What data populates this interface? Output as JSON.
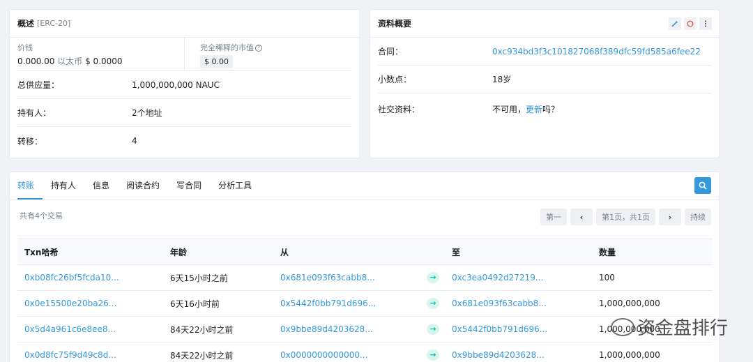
{
  "overview": {
    "title": "概述",
    "subtitle": "[ERC-20]",
    "price_label": "价钱",
    "price_value": "0.000.00",
    "price_eth": "以太币",
    "price_usd": "$ 0.0000",
    "mcap_label": "完全稀释的市值",
    "mcap_value": "$ 0.00",
    "rows": [
      {
        "label": "总供应量：",
        "value": "1,000,000,000 NAUC"
      },
      {
        "label": "持有人：",
        "value": "2个地址"
      },
      {
        "label": "转移：",
        "value": "4"
      }
    ]
  },
  "profile": {
    "title": "资料概要",
    "contract_label": "合同：",
    "contract_value": "0xc934bd3f3c101827068f389dfc59fd585a6fee22",
    "decimals_label": "小数点：",
    "decimals_value": "18岁",
    "social_label": "社交资料：",
    "social_prefix": "不可用，",
    "social_link": "更新",
    "social_suffix": "吗？"
  },
  "tabs": [
    "转账",
    "持有人",
    "信息",
    "阅读合约",
    "写合同",
    "分析工具"
  ],
  "toolbar": {
    "count_text": "共有4个交易",
    "first": "第一",
    "page_info": "第1页，共1页",
    "last": "持续"
  },
  "table": {
    "headers": [
      "Txn哈希",
      "年龄",
      "从",
      "",
      "至",
      "数量"
    ],
    "rows": [
      {
        "hash": "0xb08fc26bf5fcda10...",
        "age": "6天15小时之前",
        "from": "0x681e093f63cabb8...",
        "to": "0xc3ea0492d27219...",
        "qty": "100"
      },
      {
        "hash": "0x0e15500e20ba26...",
        "age": "6天16小时前",
        "from": "0x5442f0bb791d696...",
        "to": "0x681e093f63cabb8...",
        "qty": "1,000,000,000"
      },
      {
        "hash": "0x5d4a961c6e8ee8...",
        "age": "84天22小时之前",
        "from": "0x9bbe89d4203628...",
        "to": "0x5442f0bb791d696...",
        "qty": "1,000,000,000"
      },
      {
        "hash": "0x0d8fc75f9d49c8d...",
        "age": "84天22小时之前",
        "from": "0x0000000000000...",
        "to": "0x9bbe89d4203628...",
        "qty": "1,000,000,000"
      }
    ]
  },
  "watermark": "资金盘排行"
}
